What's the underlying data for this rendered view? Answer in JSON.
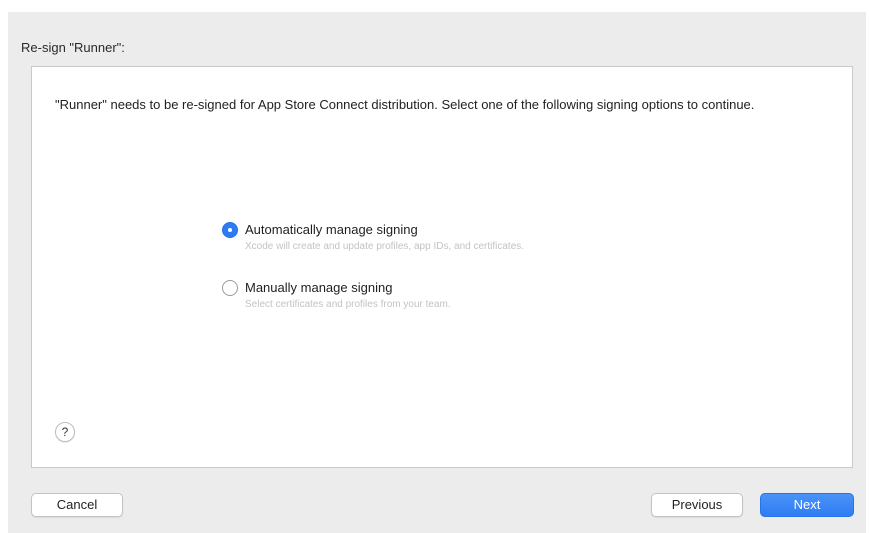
{
  "sheet": {
    "title": "Re-sign \"Runner\":"
  },
  "content": {
    "description": "\"Runner\" needs to be re-signed for App Store Connect distribution. Select one of the following signing options to continue."
  },
  "signing_options": [
    {
      "label": "Automatically manage signing",
      "subtitle": "Xcode will create and update profiles, app IDs, and certificates.",
      "selected": true
    },
    {
      "label": "Manually manage signing",
      "subtitle": "Select certificates and profiles from your team.",
      "selected": false
    }
  ],
  "help": {
    "glyph": "?"
  },
  "buttons": {
    "cancel_label": "Cancel",
    "previous_label": "Previous",
    "next_label": "Next"
  },
  "colors": {
    "accent": "#2d7cf6",
    "sheet_background": "#ececec"
  }
}
